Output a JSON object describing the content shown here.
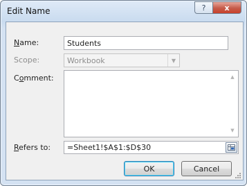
{
  "window": {
    "title": "Edit Name",
    "help_glyph": "?",
    "close_glyph": "x"
  },
  "form": {
    "name_label": "Name:",
    "name_value": "Students",
    "scope_label": "Scope:",
    "scope_value": "Workbook",
    "comment_label": "Comment:",
    "comment_value": "",
    "refers_label": "Refers to:",
    "refers_value": "=Sheet1!$A$1:$D$30"
  },
  "buttons": {
    "ok": "OK",
    "cancel": "Cancel"
  },
  "colors": {
    "title_bar": "#c9dbef",
    "client": "#f0f0f0",
    "close_button": "#c8402b"
  }
}
